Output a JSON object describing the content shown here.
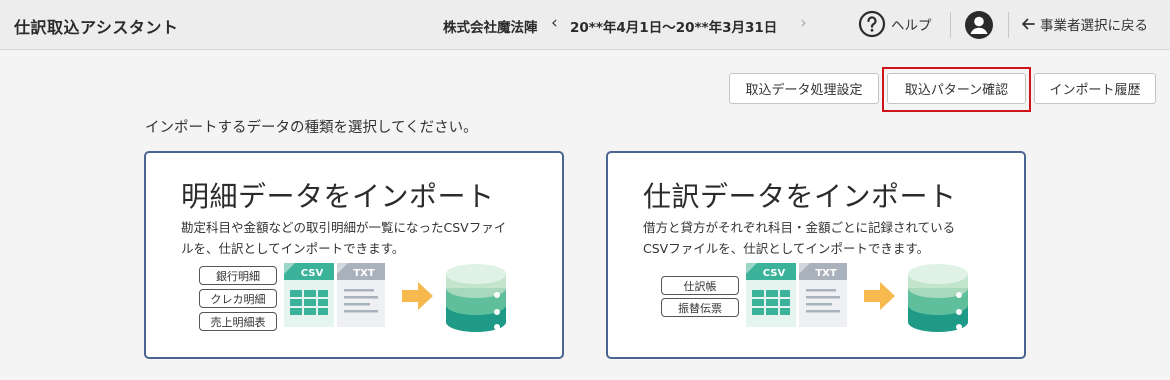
{
  "header": {
    "app_title": "仕訳取込アシスタント",
    "company": "株式会社魔法陣",
    "prev_icon": "chevron-left-icon",
    "period": "20**年4月1日～20**年3月31日",
    "next_icon": "chevron-right-icon",
    "help_label": "ヘルプ",
    "back_label": "事業者選択に戻る"
  },
  "toolbar": {
    "settings_label": "取込データ処理設定",
    "pattern_label": "取込パターン確認",
    "history_label": "インポート履歴",
    "highlight_color": "#d0121b"
  },
  "prompt": "インポートするデータの種類を選択してください。",
  "cards": [
    {
      "title": "明細データをインポート",
      "desc_line1": "勘定科目や金額などの取引明細が一覧になったCSVファイ",
      "desc_line2": "ルを、仕訳としてインポートできます。",
      "tags": [
        "銀行明細",
        "クレカ明細",
        "売上明細表"
      ]
    },
    {
      "title": "仕訳データをインポート",
      "desc_line1": "借方と貸方がそれぞれ科目・金額ごとに記録されている",
      "desc_line2": "CSVファイルを、仕訳としてインポートできます。",
      "tags": [
        "仕訳帳",
        "振替伝票"
      ]
    }
  ],
  "illustration": {
    "csv_label": "CSV",
    "txt_label": "TXT",
    "csv_color": "#3bb39a",
    "txt_color": "#a9b1bd",
    "arrow_color": "#f5b94d",
    "db_colors": [
      "#c2e5cc",
      "#5fbf9d",
      "#1f9a86"
    ]
  },
  "card_border_color": "#4a6690"
}
